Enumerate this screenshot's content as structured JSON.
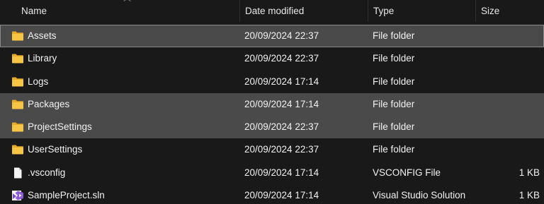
{
  "columns": {
    "name": "Name",
    "date_modified": "Date modified",
    "type": "Type",
    "size": "Size"
  },
  "sort": {
    "column": "name",
    "indicator_icon": "chevron-up-icon"
  },
  "colors": {
    "background": "#191919",
    "selection": "#4a4a4a",
    "folder": "#f4c13b",
    "text": "#f2f2f2"
  },
  "files": [
    {
      "name": "Assets",
      "date": "20/09/2024 22:37",
      "type": "File folder",
      "size": "",
      "icon": "folder-icon",
      "selected": true,
      "focused": true
    },
    {
      "name": "Library",
      "date": "20/09/2024 22:37",
      "type": "File folder",
      "size": "",
      "icon": "folder-icon",
      "selected": false,
      "focused": false
    },
    {
      "name": "Logs",
      "date": "20/09/2024 17:14",
      "type": "File folder",
      "size": "",
      "icon": "folder-icon",
      "selected": false,
      "focused": false
    },
    {
      "name": "Packages",
      "date": "20/09/2024 17:14",
      "type": "File folder",
      "size": "",
      "icon": "folder-icon",
      "selected": true,
      "focused": false
    },
    {
      "name": "ProjectSettings",
      "date": "20/09/2024 22:37",
      "type": "File folder",
      "size": "",
      "icon": "folder-icon",
      "selected": true,
      "focused": false
    },
    {
      "name": "UserSettings",
      "date": "20/09/2024 22:37",
      "type": "File folder",
      "size": "",
      "icon": "folder-icon",
      "selected": false,
      "focused": false
    },
    {
      "name": ".vsconfig",
      "date": "20/09/2024 17:14",
      "type": "VSCONFIG File",
      "size": "1 KB",
      "icon": "file-icon",
      "selected": false,
      "focused": false
    },
    {
      "name": "SampleProject.sln",
      "date": "20/09/2024 17:14",
      "type": "Visual Studio Solution",
      "size": "1 KB",
      "icon": "visual-studio-solution-icon",
      "selected": false,
      "focused": false
    }
  ]
}
